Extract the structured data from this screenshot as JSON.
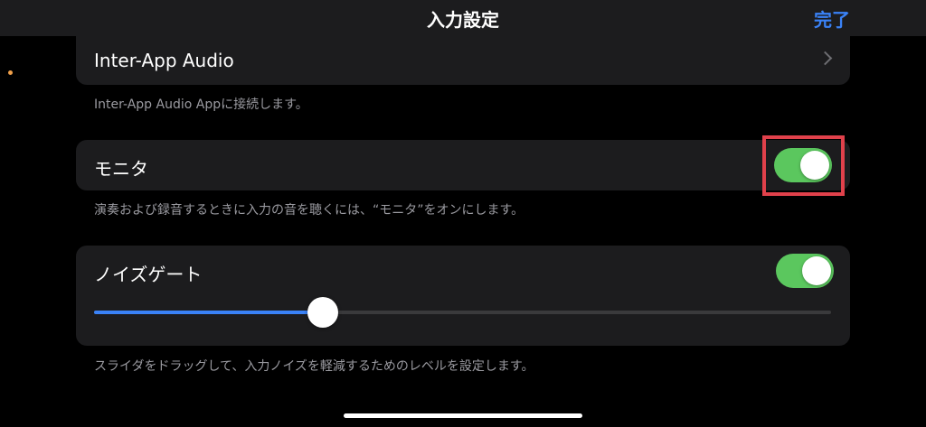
{
  "nav": {
    "title": "入力設定",
    "done_label": "完了",
    "accent_color": "#3a82f7"
  },
  "inter_app_audio": {
    "label": "Inter-App Audio",
    "chevron_icon": "chevron-right-icon",
    "footnote": "Inter-App Audio Appに接続します。"
  },
  "monitor": {
    "label": "モニタ",
    "toggle_on": true,
    "footnote": "演奏および録音するときに入力の音を聴くには、“モニタ”をオンにします。",
    "highlight_color": "#e0414b"
  },
  "noise_gate": {
    "label": "ノイズゲート",
    "toggle_on": true,
    "slider_level": 0.31,
    "footnote": "スライダをドラッグして、入力ノイズを軽減するためのレベルを設定します。"
  },
  "colors": {
    "toggle_on": "#5bc75e",
    "slider_fill": "#3a82f7",
    "card_background": "#1c1c1e",
    "footnote_text": "#9a9aa0"
  }
}
